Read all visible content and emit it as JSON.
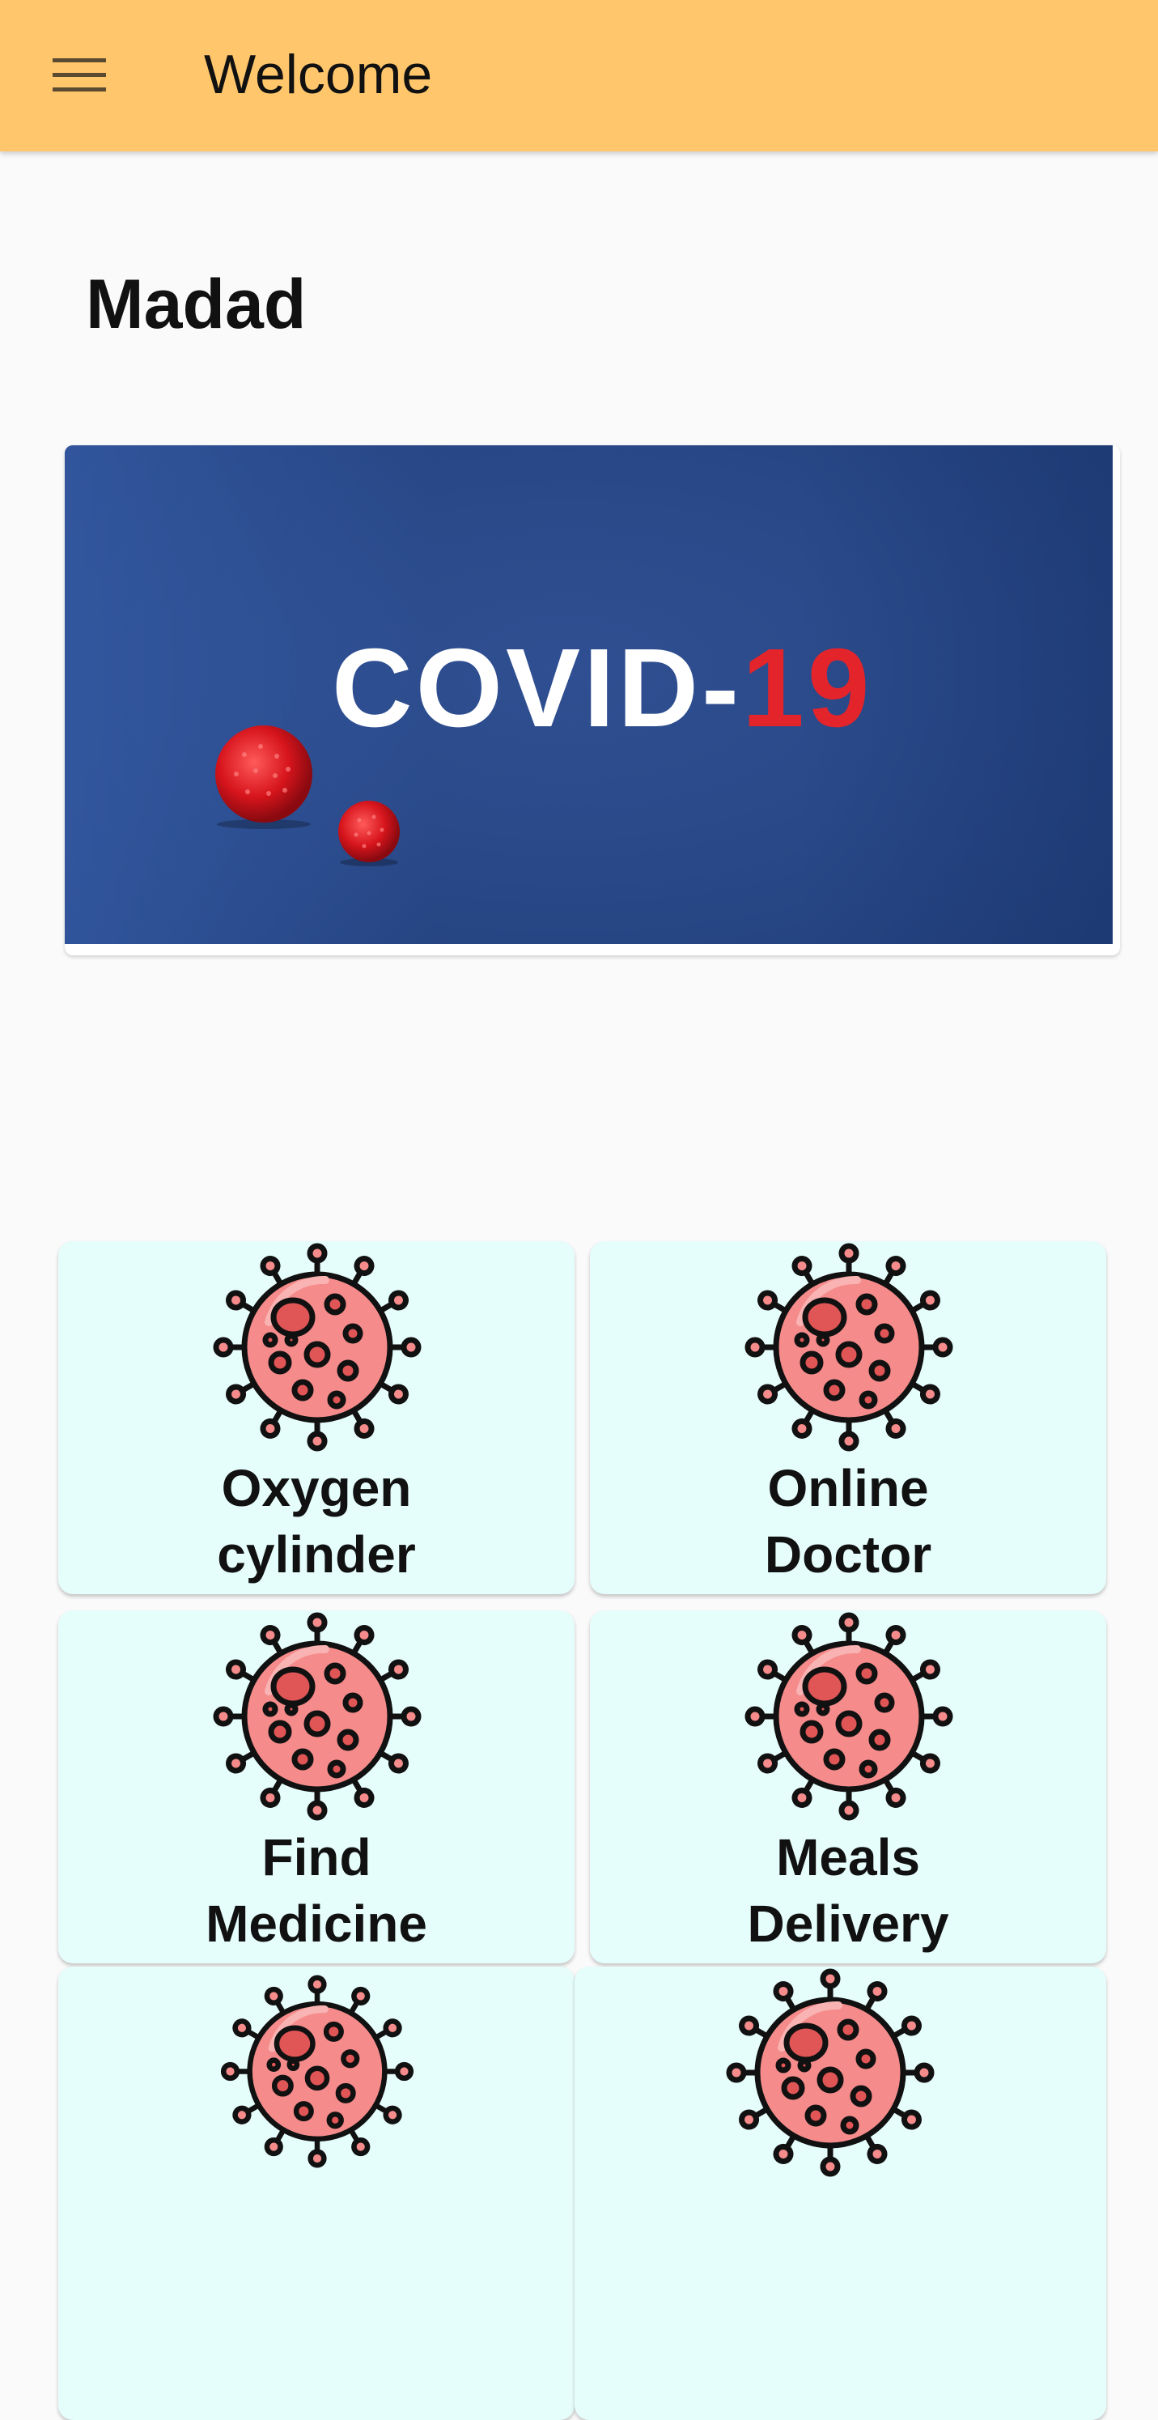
{
  "appbar": {
    "title": "Welcome",
    "menu_icon": "menu-icon",
    "background": "#ffc66b"
  },
  "page": {
    "title": "Madad",
    "background": "#fafafa"
  },
  "banner": {
    "text_white": "COVID-",
    "text_red": "19",
    "accent_red": "#e3242b",
    "bg_blue": "#2a4a8a"
  },
  "tiles": [
    {
      "line1": "Oxygen",
      "line2": "cylinder",
      "icon": "virus-icon"
    },
    {
      "line1": "Online",
      "line2": "Doctor",
      "icon": "virus-icon"
    },
    {
      "line1": "Find",
      "line2": "Medicine",
      "icon": "virus-icon"
    },
    {
      "line1": "Meals",
      "line2": "Delivery",
      "icon": "virus-icon"
    },
    {
      "line1": "",
      "line2": "",
      "icon": "virus-icon"
    },
    {
      "line1": "",
      "line2": "",
      "icon": "virus-icon"
    }
  ],
  "colors": {
    "tile_bg": "#e5fdfb",
    "virus_fill": "#f58b8b",
    "virus_dark": "#e05555",
    "virus_stroke": "#111111"
  }
}
